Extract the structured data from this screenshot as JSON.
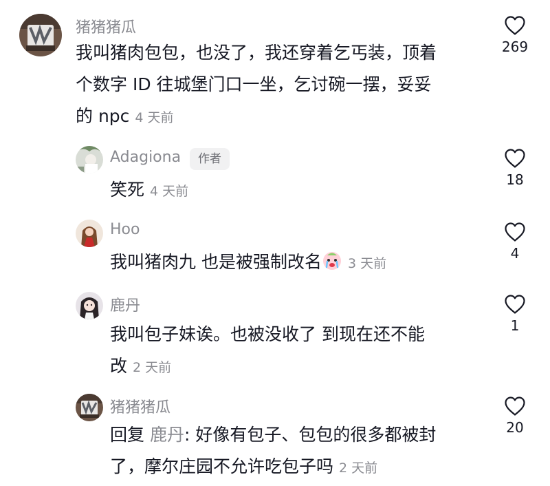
{
  "comments": [
    {
      "username": "猪猪猪瓜",
      "text_lines": [
        "我叫猪肉包包，也没了，我还穿着乞丐装，顶着",
        "个数字 ID 往城堡门口一坐，乞讨碗一摆，妥妥",
        "的 npc"
      ],
      "time": "4 天前",
      "likes": "269"
    }
  ],
  "replies": [
    {
      "username": "Adagiona",
      "badge": "作者",
      "text": "笑死",
      "time": "4 天前",
      "likes": "18"
    },
    {
      "username": "Hoo",
      "text": "我叫猪肉九 也是被强制改名",
      "emoji": "crying-face",
      "time": "3 天前",
      "likes": "4"
    },
    {
      "username": "鹿丹",
      "text_lines": [
        "我叫包子妹诶。也被没收了  到现在还不能",
        "改"
      ],
      "time": "2 天前",
      "likes": "1"
    },
    {
      "username": "猪猪猪瓜",
      "reply_prefix": "回复",
      "reply_to": "鹿丹",
      "text_lines": [
        ": 好像有包子、包包的很多都被封",
        "了，摩尔庄园不允许吃包子吗"
      ],
      "time": "2 天前",
      "likes": "20"
    }
  ],
  "icons": {
    "like": "heart-outline-icon",
    "emoji": "crying-face-emoji"
  },
  "colors": {
    "primary_text": "#161823",
    "secondary_text": "#8a8b91",
    "badge_bg": "#f1f1f2"
  }
}
